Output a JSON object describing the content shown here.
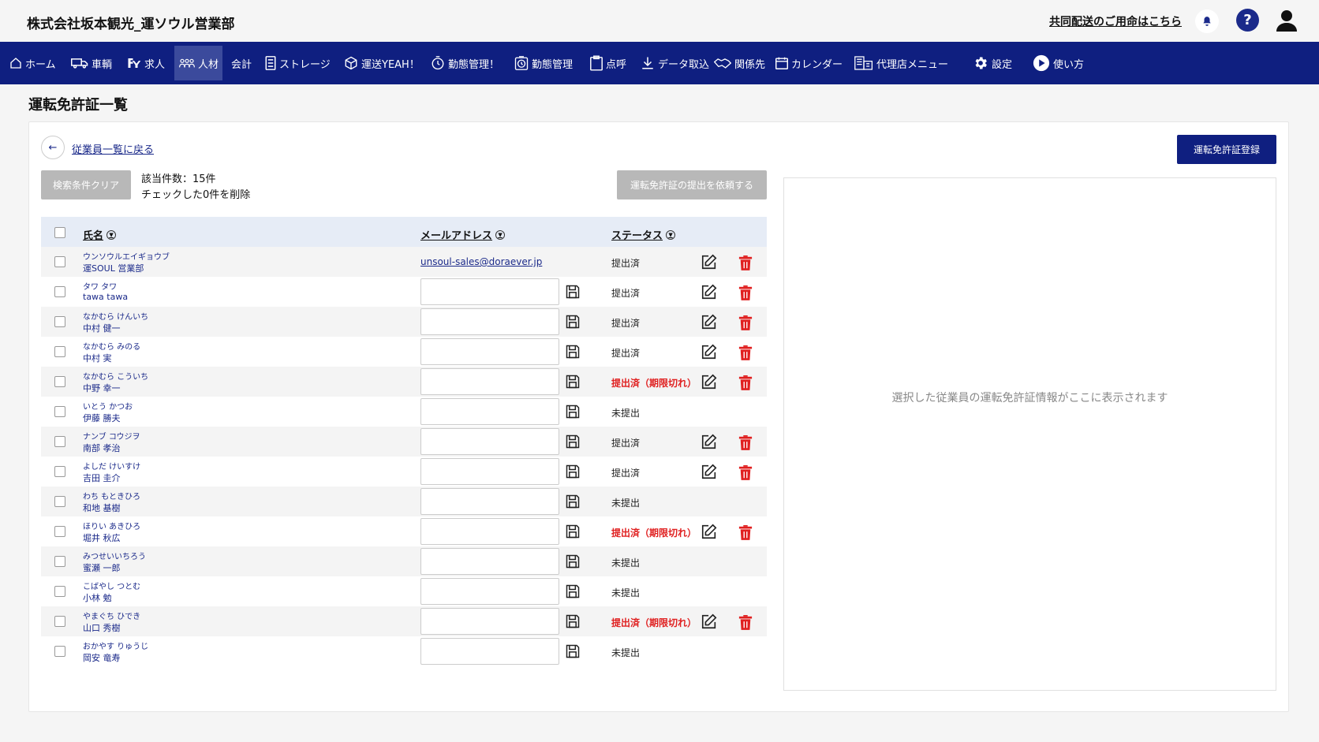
{
  "header": {
    "company_name": "株式会社坂本観光_運ソウル営業部",
    "shared_delivery_link": "共同配送のご用命はこちら",
    "help_label": "?"
  },
  "nav": {
    "items": [
      {
        "label": "ホーム",
        "icon": "home-icon"
      },
      {
        "label": "車輌",
        "icon": "truck-icon"
      },
      {
        "label": "求人",
        "icon": "recruit-icon"
      },
      {
        "label": "人材",
        "icon": "people-icon",
        "active": true
      },
      {
        "label": "会計",
        "icon": ""
      },
      {
        "label": "ストレージ",
        "icon": "storage-icon"
      },
      {
        "label": "運送YEAH！",
        "icon": "box-icon"
      },
      {
        "label": "勤態管理！",
        "icon": "attendance-icon"
      },
      {
        "label": "勤態管理",
        "icon": "attendance-icon"
      },
      {
        "label": "点呼",
        "icon": "clipboard-icon"
      },
      {
        "label": "データ取込",
        "icon": "download-icon"
      },
      {
        "label": "関係先",
        "icon": "handshake-icon"
      },
      {
        "label": "カレンダー",
        "icon": "calendar-icon"
      },
      {
        "label": "代理店メニュー",
        "icon": "agency-icon"
      },
      {
        "label": "設定",
        "icon": "gear-icon"
      },
      {
        "label": "使い方",
        "icon": "play-icon"
      }
    ]
  },
  "page": {
    "title": "運転免許証一覧",
    "back_link": "従業員一覧に戻る",
    "back_arrow": "←",
    "clear_button": "検索条件クリア",
    "count_text": "該当件数：15件",
    "delete_checked": "チェックした0件を削除",
    "request_button": "運転免許証の提出を依頼する",
    "register_button": "運転免許証登録",
    "detail_placeholder": "選択した従業員の運転免許証情報がここに表示されます"
  },
  "table": {
    "headers": {
      "name": "氏名",
      "email": "メールアドレス",
      "status": "ステータス"
    },
    "sort_glyph": "▼",
    "rows": [
      {
        "kana": "ウンソウルエイギョウブ",
        "kanji": "運SOUL 営業部",
        "email": "unsoul-sales@doraever.jp",
        "status": "提出済",
        "expired": false,
        "has_actions": true
      },
      {
        "kana": "タワ タワ",
        "kanji": "tawa tawa",
        "email": "",
        "status": "提出済",
        "expired": false,
        "has_actions": true
      },
      {
        "kana": "なかむら けんいち",
        "kanji": "中村 健一",
        "email": "",
        "status": "提出済",
        "expired": false,
        "has_actions": true
      },
      {
        "kana": "なかむら みのる",
        "kanji": "中村 実",
        "email": "",
        "status": "提出済",
        "expired": false,
        "has_actions": true
      },
      {
        "kana": "なかむら こういち",
        "kanji": "中野 幸一",
        "email": "",
        "status": "提出済（期限切れ）",
        "expired": true,
        "has_actions": true
      },
      {
        "kana": "いとう かつお",
        "kanji": "伊藤 勝夫",
        "email": "",
        "status": "未提出",
        "expired": false,
        "has_actions": false
      },
      {
        "kana": "ナンブ コウジヲ",
        "kanji": "南部 孝治",
        "email": "",
        "status": "提出済",
        "expired": false,
        "has_actions": true
      },
      {
        "kana": "よしだ けいすけ",
        "kanji": "吉田 圭介",
        "email": "",
        "status": "提出済",
        "expired": false,
        "has_actions": true
      },
      {
        "kana": "わち もときひろ",
        "kanji": "和地 基樹",
        "email": "",
        "status": "未提出",
        "expired": false,
        "has_actions": false
      },
      {
        "kana": "ほりい あきひろ",
        "kanji": "堀井 秋広",
        "email": "",
        "status": "提出済（期限切れ）",
        "expired": true,
        "has_actions": true
      },
      {
        "kana": "みつせいいちろう",
        "kanji": "蜜瀬 一郎",
        "email": "",
        "status": "未提出",
        "expired": false,
        "has_actions": false
      },
      {
        "kana": "こばやし つとむ",
        "kanji": "小林 勉",
        "email": "",
        "status": "未提出",
        "expired": false,
        "has_actions": false
      },
      {
        "kana": "やまぐち ひでき",
        "kanji": "山口 秀樹",
        "email": "",
        "status": "提出済（期限切れ）",
        "expired": true,
        "has_actions": true
      },
      {
        "kana": "おかやす りゅうじ",
        "kanji": "岡安 竜寿",
        "email": "",
        "status": "未提出",
        "expired": false,
        "has_actions": false
      }
    ]
  },
  "colors": {
    "nav_bg": "#0f1f80",
    "link": "#1b2a8a",
    "expired": "#e02020",
    "trash": "#e02020"
  }
}
